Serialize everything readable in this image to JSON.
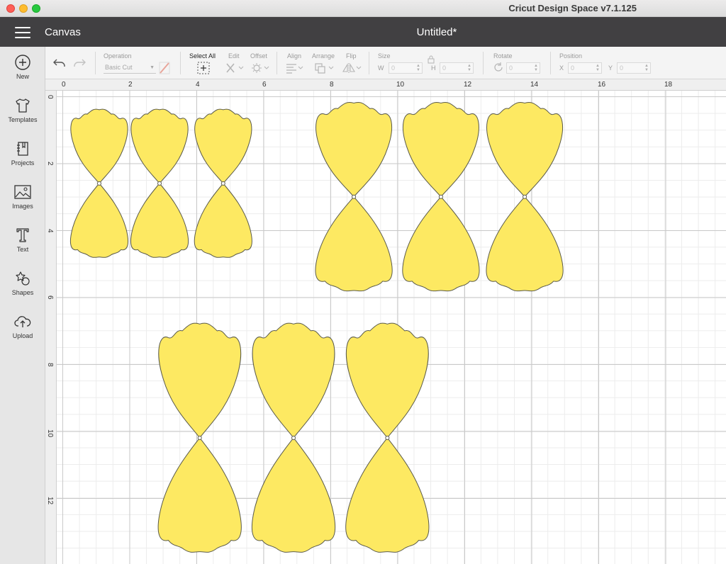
{
  "window": {
    "title": "Cricut Design Space  v7.1.125"
  },
  "header": {
    "canvas_label": "Canvas",
    "document_title": "Untitled*"
  },
  "sidebar": {
    "items": [
      {
        "label": "New",
        "icon": "plus-circle-icon"
      },
      {
        "label": "Templates",
        "icon": "tshirt-icon"
      },
      {
        "label": "Projects",
        "icon": "notebook-icon"
      },
      {
        "label": "Images",
        "icon": "image-icon"
      },
      {
        "label": "Text",
        "icon": "text-t-icon"
      },
      {
        "label": "Shapes",
        "icon": "shapes-icon"
      },
      {
        "label": "Upload",
        "icon": "cloud-upload-icon"
      }
    ]
  },
  "toolbar": {
    "operation_label": "Operation",
    "operation_value": "Basic Cut",
    "select_all_label": "Select All",
    "edit_label": "Edit",
    "offset_label": "Offset",
    "align_label": "Align",
    "arrange_label": "Arrange",
    "flip_label": "Flip",
    "size_label": "Size",
    "width_label": "W",
    "width_value": "0",
    "height_label": "H",
    "height_value": "0",
    "rotate_label": "Rotate",
    "rotate_value": "0",
    "position_label": "Position",
    "x_label": "X",
    "x_value": "0",
    "y_label": "Y",
    "y_value": "0"
  },
  "rulers": {
    "top": [
      "0",
      "2",
      "4",
      "6",
      "8",
      "10",
      "12",
      "14",
      "16",
      "18"
    ],
    "left": [
      "0",
      "2",
      "4",
      "6",
      "8",
      "10",
      "12"
    ]
  },
  "shapes": {
    "fill_color": "#fde962",
    "stroke_color": "#5a5a4a",
    "pieces": [
      {
        "row": 1,
        "x_in": 0.2,
        "y_in": 0.4,
        "w_in": 1.8,
        "h_in": 4.4
      },
      {
        "row": 1,
        "x_in": 2.0,
        "y_in": 0.4,
        "w_in": 1.8,
        "h_in": 4.4
      },
      {
        "row": 1,
        "x_in": 3.9,
        "y_in": 0.4,
        "w_in": 1.8,
        "h_in": 4.4
      },
      {
        "row": 2,
        "x_in": 7.5,
        "y_in": 0.2,
        "w_in": 2.4,
        "h_in": 5.6
      },
      {
        "row": 2,
        "x_in": 10.1,
        "y_in": 0.2,
        "w_in": 2.4,
        "h_in": 5.6
      },
      {
        "row": 2,
        "x_in": 12.6,
        "y_in": 0.2,
        "w_in": 2.4,
        "h_in": 5.6
      },
      {
        "row": 3,
        "x_in": 2.8,
        "y_in": 6.8,
        "w_in": 2.6,
        "h_in": 6.8
      },
      {
        "row": 3,
        "x_in": 5.6,
        "y_in": 6.8,
        "w_in": 2.6,
        "h_in": 6.8
      },
      {
        "row": 3,
        "x_in": 8.4,
        "y_in": 6.8,
        "w_in": 2.6,
        "h_in": 6.8
      }
    ]
  }
}
